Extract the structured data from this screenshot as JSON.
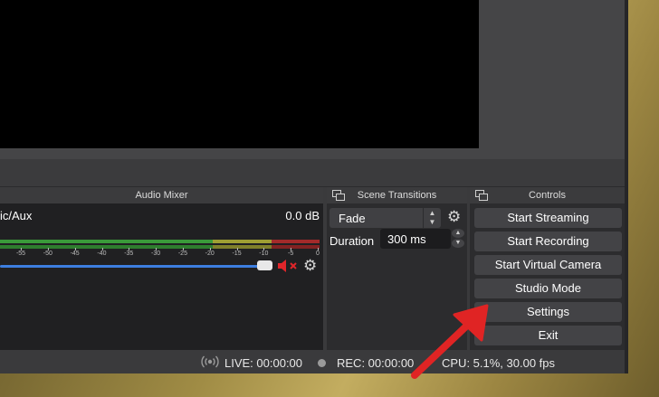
{
  "mixer": {
    "title": "Audio Mixer",
    "channel_name": "ic/Aux",
    "channel_db": "0.0 dB",
    "ticks": [
      "-55",
      "-50",
      "-45",
      "-40",
      "-35",
      "-30",
      "-25",
      "-20",
      "-15",
      "-10",
      "-5",
      "0"
    ],
    "volume_fraction": 0.83,
    "muted": true
  },
  "transitions": {
    "title": "Scene Transitions",
    "selected": "Fade",
    "duration_label": "Duration",
    "duration_value": "300 ms"
  },
  "controls": {
    "title": "Controls",
    "buttons": [
      "Start Streaming",
      "Start Recording",
      "Start Virtual Camera",
      "Studio Mode",
      "Settings",
      "Exit"
    ]
  },
  "status": {
    "live": "LIVE: 00:00:00",
    "rec": "REC: 00:00:00",
    "cpu": "CPU: 5.1%, 30.00 fps"
  },
  "colors": {
    "accent": "#3d7ee0",
    "mute": "#e0252a",
    "annotation_arrow": "#e02424"
  },
  "icons": [
    "dock-float-icon",
    "gear-icon",
    "mute-speaker-icon",
    "broadcast-icon",
    "record-dot-icon",
    "chevron-updown-icon",
    "annotation-arrow"
  ]
}
